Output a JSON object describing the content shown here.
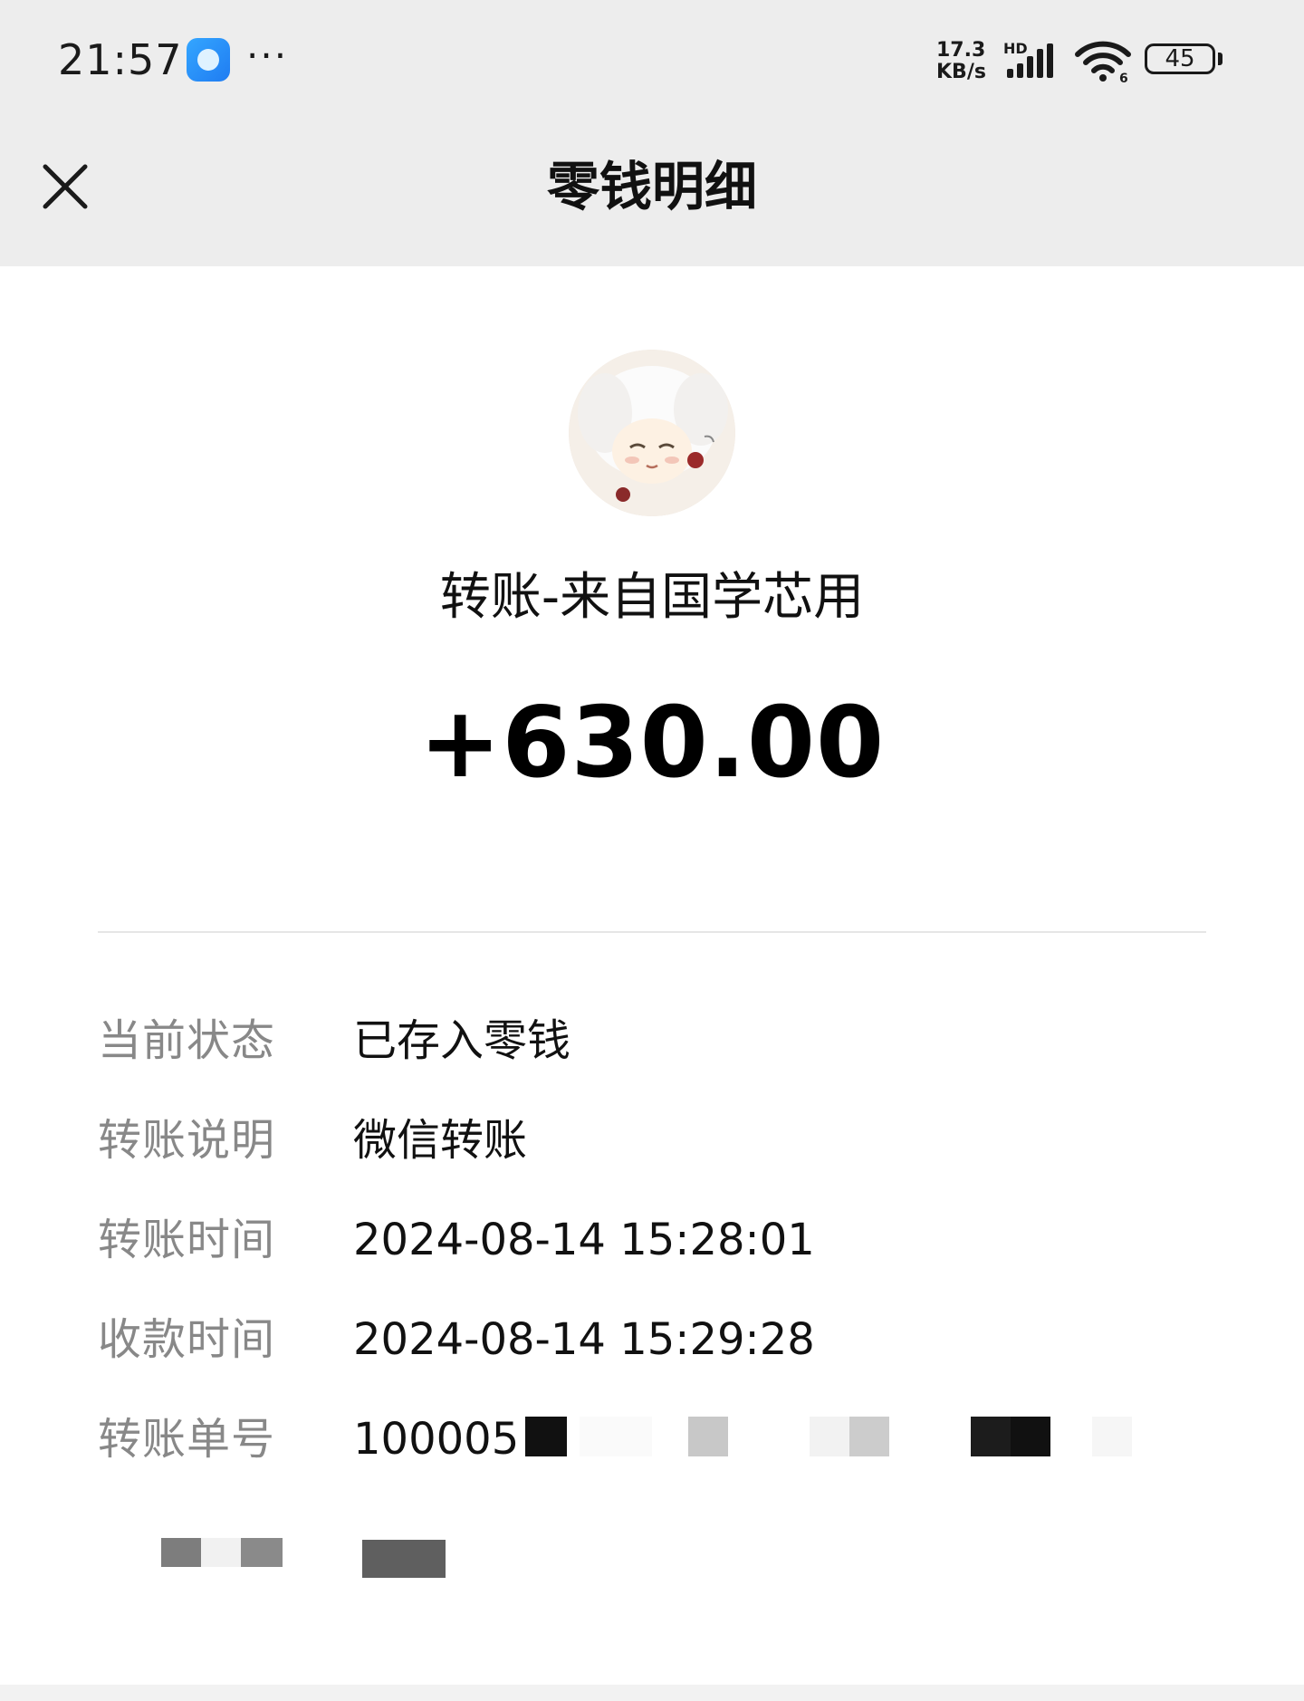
{
  "status_bar": {
    "time": "21:57",
    "more": "···",
    "speed_value": "17.3",
    "speed_unit": "KB/s",
    "network": "HD",
    "wifi_label": "6",
    "battery": "45"
  },
  "nav": {
    "title": "零钱明细"
  },
  "transaction": {
    "title": "转账-来自国学芯用",
    "amount": "+630.00"
  },
  "details": [
    {
      "label": "当前状态",
      "value": "已存入零钱"
    },
    {
      "label": "转账说明",
      "value": "微信转账"
    },
    {
      "label": "转账时间",
      "value": "2024-08-14 15:28:01"
    },
    {
      "label": "收款时间",
      "value": "2024-08-14 15:29:28"
    },
    {
      "label": "转账单号",
      "value": "100005"
    }
  ],
  "colors": {
    "header_bg": "#ededed",
    "label": "#888888",
    "text": "#111111"
  },
  "icons": [
    "app-icon",
    "more-icon",
    "signal-icon",
    "wifi-icon",
    "battery-icon",
    "close-icon",
    "avatar"
  ]
}
